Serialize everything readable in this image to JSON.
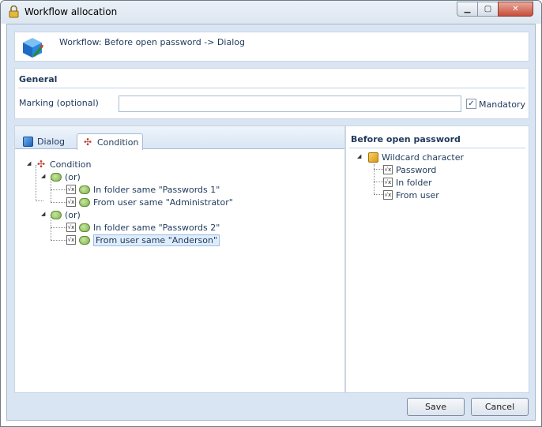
{
  "window": {
    "title": "Workflow allocation"
  },
  "header": {
    "text": "Workflow: Before open password -> Dialog"
  },
  "general": {
    "title": "General",
    "marking_label": "Marking (optional)",
    "marking_value": "",
    "mandatory_label": "Mandatory",
    "mandatory_checked": true
  },
  "tabs": [
    {
      "label": "Dialog"
    },
    {
      "label": "Condition"
    }
  ],
  "tree": {
    "root": "Condition",
    "or1": "(or)",
    "or1_items": [
      "In folder same \"Passwords 1\"",
      "From user same \"Administrator\""
    ],
    "or2": "(or)",
    "or2_items": [
      "In folder same \"Passwords 2\"",
      "From user same \"Anderson\""
    ]
  },
  "right_panel": {
    "title": "Before open password",
    "root": "Wildcard character",
    "items": [
      "Password",
      "In folder",
      "From user"
    ]
  },
  "buttons": {
    "save": "Save",
    "cancel": "Cancel"
  },
  "colors": {
    "accent": "#1e395b",
    "panel_bg": "#d9e5f3",
    "selection": "#dfecfb"
  }
}
